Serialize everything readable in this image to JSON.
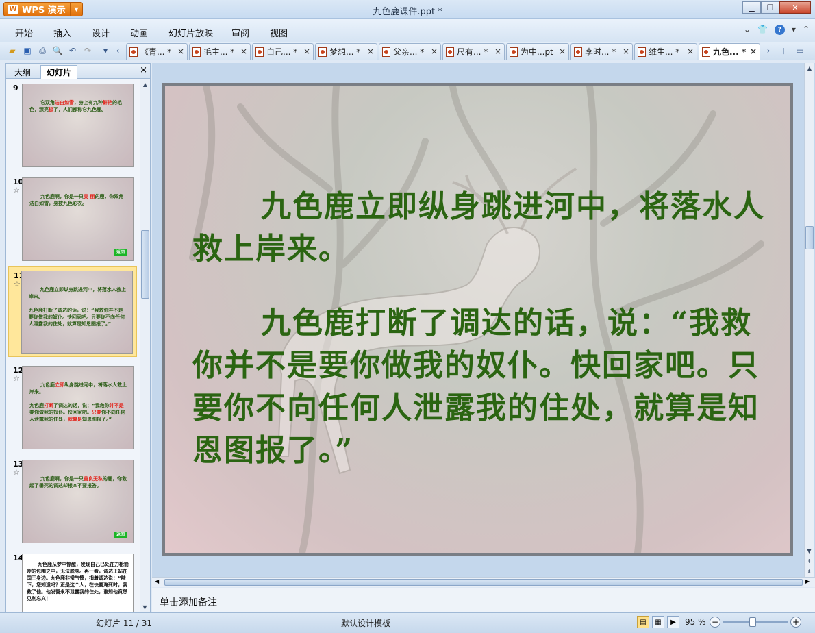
{
  "app": {
    "name": "WPS 演示",
    "logo": "W"
  },
  "window": {
    "title": "九色鹿课件.ppt *",
    "controls": [
      "minimize",
      "maximize",
      "close"
    ]
  },
  "menu": {
    "items": [
      "开始",
      "插入",
      "设计",
      "动画",
      "幻灯片放映",
      "审阅",
      "视图"
    ]
  },
  "doc_tabs": [
    {
      "label": "《青... *"
    },
    {
      "label": "毛主... *"
    },
    {
      "label": "自己... *"
    },
    {
      "label": "梦想... *"
    },
    {
      "label": "父亲... *"
    },
    {
      "label": "尺有... *"
    },
    {
      "label": "为中...pt"
    },
    {
      "label": "李时... *"
    },
    {
      "label": "维生... *"
    },
    {
      "label": "九色... *",
      "active": true
    }
  ],
  "left_panel": {
    "tabs": [
      "大纲",
      "幻灯片"
    ],
    "active_tab": "幻灯片",
    "close": "×"
  },
  "slides": [
    {
      "num": "9",
      "star": "",
      "text_parts": [
        [
          "它双角",
          ""
        ],
        [
          "洁白如雪",
          "red"
        ],
        [
          "，身上有九种",
          ""
        ],
        [
          "鲜艳",
          "red"
        ],
        [
          "的毛色，漂亮",
          ""
        ],
        [
          "极",
          "red"
        ],
        [
          "了，人们都称它九色鹿。",
          ""
        ]
      ]
    },
    {
      "num": "10",
      "star": "☆",
      "text_parts": [
        [
          "九色鹿啊，你是一只",
          ""
        ],
        [
          "美 丽",
          "red"
        ],
        [
          "的鹿，你双角洁白如雪，身披九色彩衣。",
          ""
        ]
      ],
      "badge": "返回"
    },
    {
      "num": "11",
      "star": "☆",
      "text_parts": [
        [
          "九色鹿立即纵身跳进河中，将落水人救上岸来。",
          ""
        ],
        [
          "\n九色鹿打断了调达的话，说：“我救你并不是要你做我的奴仆。快回家吧。只要你不向任何人泄露我的住处，就算是知恩图报了。”",
          ""
        ]
      ],
      "selected": true
    },
    {
      "num": "12",
      "star": "☆",
      "text_parts": [
        [
          "九色鹿",
          ""
        ],
        [
          "立即",
          "red"
        ],
        [
          "纵身跳进河中，将落水人救上岸来。",
          ""
        ],
        [
          "\n九色鹿",
          ""
        ],
        [
          "打断",
          "red"
        ],
        [
          "了调达的话，说：“我救你",
          ""
        ],
        [
          "并不是",
          "red"
        ],
        [
          "要你做我的奴仆。快回家吧。",
          ""
        ],
        [
          "只要",
          "red"
        ],
        [
          "你不向任何人泄露我的住处，",
          ""
        ],
        [
          "就算是",
          "red"
        ],
        [
          "知恩图报了。”",
          ""
        ]
      ]
    },
    {
      "num": "13",
      "star": "☆",
      "text_parts": [
        [
          "九色鹿啊，你是一只",
          ""
        ],
        [
          "善良无私",
          "red"
        ],
        [
          "的鹿，你救起了垂死的调达却根本不要报答。",
          ""
        ]
      ],
      "badge": "返回"
    },
    {
      "num": "14",
      "star": "",
      "text_parts": [
        [
          "九色鹿从梦中惊醒，发现自己已处在刀枪箭斧的包围之中，无法脱身。再一看，调达正站在国王身边。",
          ""
        ],
        [
          "九色鹿非常气愤，指着调达说：“陛下，您知道吗？正是这个人，在快要淹死时，我救了他。他发誓永不泄露我的住处，谁知他竟然见利忘义！",
          ""
        ]
      ],
      "white": true
    }
  ],
  "current_slide": {
    "paragraphs": [
      "九色鹿立即纵身跳进河中，将落水人救上岸来。",
      "九色鹿打断了调达的话，说：“我救你并不是要你做我的奴仆。快回家吧。只要你不向任何人泄露我的住处，就算是知恩图报了。”"
    ],
    "text_color": "#2b6512"
  },
  "notes": {
    "placeholder": "单击添加备注"
  },
  "status": {
    "slide_info": "幻灯片 11 / 31",
    "template": "默认设计模板",
    "zoom": "95 %"
  },
  "colors": {
    "accent": "#e87a10",
    "slide_text": "#2b6512",
    "highlight_red": "#e2241b"
  }
}
